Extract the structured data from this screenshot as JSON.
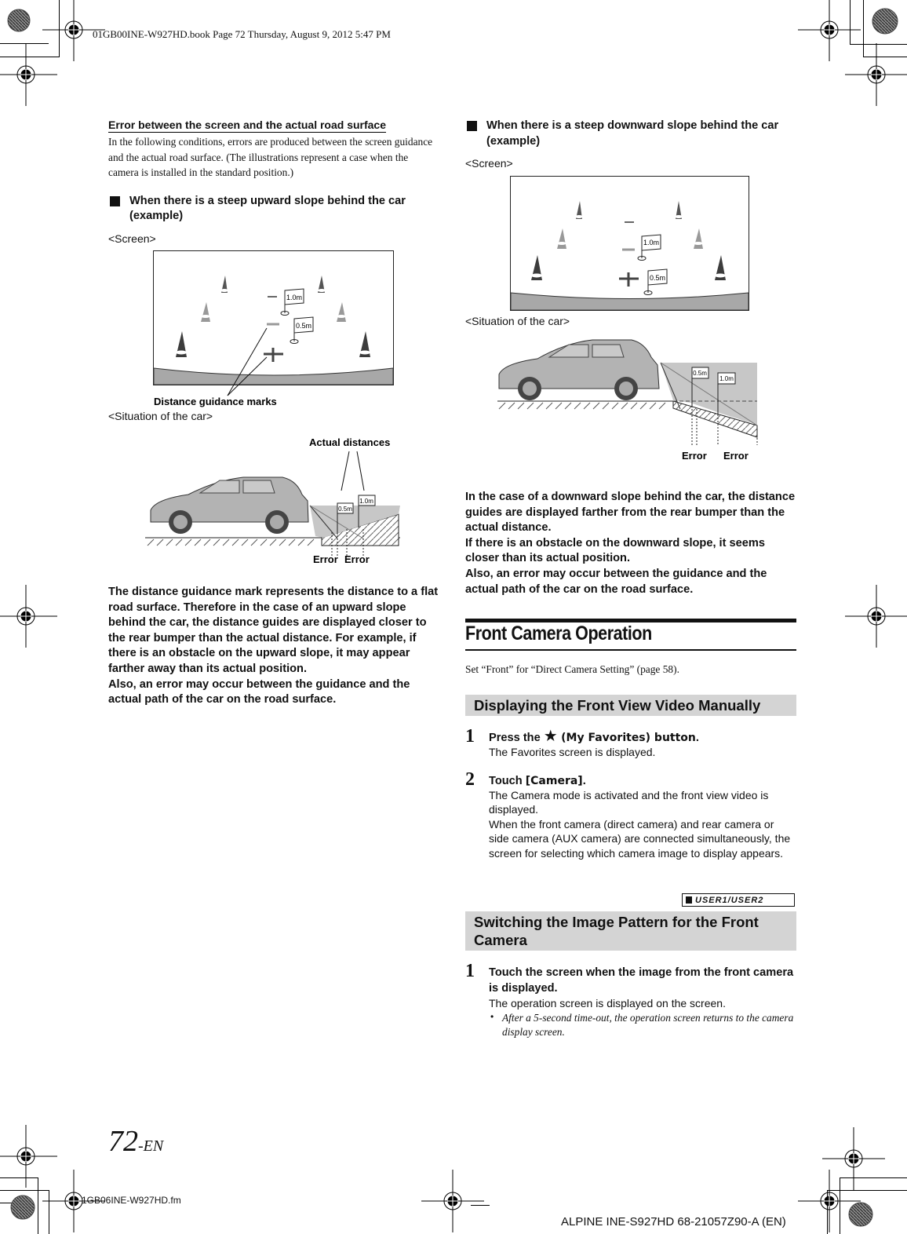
{
  "print_header": "01GB00INE-W927HD.book  Page 72  Thursday, August 9, 2012  5:47 PM",
  "left": {
    "section_title": "Error between the screen and the actual road surface",
    "intro": "In the following conditions, errors are produced between the screen guidance and the actual road surface. (The illustrations represent a case when the camera is installed in the standard position.)",
    "upward": {
      "heading": "When there is a steep upward slope behind the car (example)",
      "screen_label": "<Screen>",
      "marks_label": "Distance guidance marks",
      "flag_far": "1.0m",
      "flag_near": "0.5m",
      "situation_label": "<Situation of the car>",
      "actual_distances_label": "Actual distances",
      "error_label_1": "Error",
      "error_label_2": "Error",
      "explanation": "The distance guidance mark represents the distance to a flat road surface. Therefore in the case of an upward slope behind the car, the distance guides are displayed closer to the rear bumper than the actual distance. For example, if there is an obstacle on the upward slope, it may appear farther away than its actual position.\nAlso, an error may occur between the guidance and the actual path of the car on the road surface."
    }
  },
  "right": {
    "downward": {
      "heading": "When there is a steep downward slope behind the car (example)",
      "screen_label": "<Screen>",
      "flag_far": "1.0m",
      "flag_near": "0.5m",
      "situation_label": "<Situation of the car>",
      "error_label_1": "Error",
      "error_label_2": "Error",
      "explanation": "In the case of a downward slope behind the car, the distance guides are displayed farther from the rear bumper than the actual distance.\nIf there is an obstacle on the downward slope, it seems closer than its actual position.\nAlso, an error may occur between the guidance and the actual path of the car on the road surface."
    },
    "front_camera": {
      "title": "Front Camera Operation",
      "setup_text": "Set “Front” for “Direct Camera Setting” (page 58).",
      "display_manual": {
        "bar_title": "Displaying the Front View Video Manually",
        "steps": [
          {
            "num": "1",
            "title_prefix": "Press the ",
            "icon": "star-icon",
            "title_suffix": " (My Favorites) button",
            "title_end": ".",
            "body": "The Favorites screen is displayed."
          },
          {
            "num": "2",
            "title_prefix": "Touch ",
            "title_key": "[Camera]",
            "title_end": ".",
            "body": "The Camera mode is activated and the front view video is displayed.\nWhen the front camera (direct camera) and rear camera or side camera (AUX camera) are connected simultaneously, the screen for selecting which camera image to display appears."
          }
        ]
      },
      "user_badge": "USER1/USER2",
      "switch_pattern": {
        "bar_title": "Switching the Image Pattern for the Front Camera",
        "steps": [
          {
            "num": "1",
            "title": "Touch the screen when the image from the front camera is displayed.",
            "body": "The operation screen is displayed on the screen.",
            "note": "After a 5-second time-out, the operation screen returns to the camera display screen."
          }
        ]
      }
    }
  },
  "footer": {
    "page_number": "72",
    "page_suffix": "-EN",
    "file_name": "1GB06INE-W927HD.fm",
    "product_code": "ALPINE INE-S927HD 68-21057Z90-A (EN)"
  }
}
